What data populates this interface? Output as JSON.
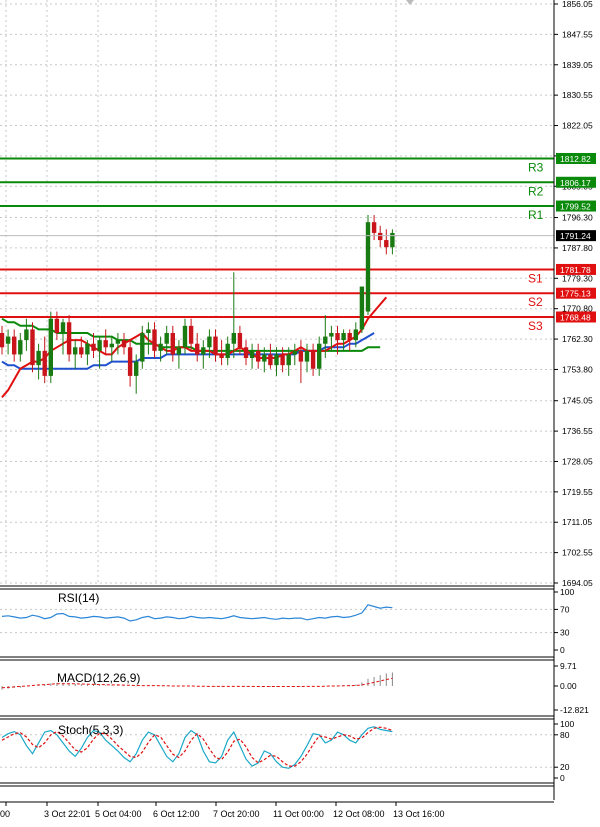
{
  "colors": {
    "up": "#1a7a12",
    "down": "#c8141a",
    "resistance": "#0a8a0a",
    "support": "#e01010",
    "ma_red": "#e01010",
    "ma_blue": "#2050d0",
    "ma_green": "#0a8a0a",
    "rsi_line": "#2a86d8",
    "stoch_main": "#1aa8c8",
    "stoch_signal": "#e01010",
    "grid": "#c8c8c8"
  },
  "chart_data": {
    "type": "candlestick",
    "price_axis": {
      "ticks": [
        "1856.05",
        "1847.55",
        "1839.05",
        "1830.55",
        "1822.05",
        "1813.55",
        "1805.05",
        "1796.30",
        "1787.80",
        "1779.30",
        "1770.80",
        "1762.30",
        "1753.80",
        "1745.05",
        "1736.55",
        "1728.05",
        "1719.55",
        "1711.05",
        "1702.55",
        "1694.05"
      ],
      "ylim": [
        1694.05,
        1856.05
      ],
      "current_price": "1791.24"
    },
    "x_labels": [
      "00",
      "3 Oct 22:01",
      "5 Oct 04:00",
      "6 Oct 12:00",
      "7 Oct 20:00",
      "11 Oct 00:00",
      "12 Oct 08:00",
      "13 Oct 16:00"
    ],
    "resistance": [
      {
        "label": "R3",
        "value": "1812.82"
      },
      {
        "label": "R2",
        "value": "1806.17"
      },
      {
        "label": "R1",
        "value": "1799.52"
      }
    ],
    "support": [
      {
        "label": "S1",
        "value": "1781.78"
      },
      {
        "label": "S2",
        "value": "1775.13"
      },
      {
        "label": "S3",
        "value": "1768.48"
      }
    ],
    "candles": [
      [
        1764,
        1766,
        1758,
        1760
      ],
      [
        1761,
        1765,
        1758,
        1763
      ],
      [
        1763,
        1765,
        1756,
        1758
      ],
      [
        1758,
        1764,
        1756,
        1762
      ],
      [
        1762,
        1768,
        1759,
        1765
      ],
      [
        1765,
        1767,
        1753,
        1755
      ],
      [
        1755,
        1761,
        1751,
        1759
      ],
      [
        1759,
        1763,
        1750,
        1752
      ],
      [
        1752,
        1770,
        1750,
        1768
      ],
      [
        1768,
        1770,
        1762,
        1764
      ],
      [
        1764,
        1768,
        1758,
        1767
      ],
      [
        1767,
        1769,
        1756,
        1758
      ],
      [
        1758,
        1762,
        1754,
        1760
      ],
      [
        1760,
        1763,
        1757,
        1758
      ],
      [
        1758,
        1762,
        1755,
        1761
      ],
      [
        1761,
        1764,
        1757,
        1759
      ],
      [
        1759,
        1763,
        1754,
        1762
      ],
      [
        1762,
        1765,
        1758,
        1760
      ],
      [
        1760,
        1763,
        1756,
        1761
      ],
      [
        1761,
        1764,
        1758,
        1762
      ],
      [
        1762,
        1764,
        1758,
        1760
      ],
      [
        1760,
        1762,
        1749,
        1752
      ],
      [
        1752,
        1758,
        1747,
        1756
      ],
      [
        1756,
        1766,
        1754,
        1764
      ],
      [
        1764,
        1767,
        1758,
        1765
      ],
      [
        1765,
        1767,
        1757,
        1759
      ],
      [
        1759,
        1763,
        1756,
        1761
      ],
      [
        1761,
        1766,
        1758,
        1764
      ],
      [
        1764,
        1766,
        1756,
        1758
      ],
      [
        1758,
        1762,
        1754,
        1760
      ],
      [
        1760,
        1768,
        1758,
        1766
      ],
      [
        1766,
        1768,
        1759,
        1761
      ],
      [
        1761,
        1764,
        1756,
        1758
      ],
      [
        1758,
        1762,
        1754,
        1760
      ],
      [
        1760,
        1765,
        1757,
        1763
      ],
      [
        1763,
        1765,
        1756,
        1758
      ],
      [
        1758,
        1762,
        1755,
        1757
      ],
      [
        1757,
        1763,
        1755,
        1761
      ],
      [
        1761,
        1781,
        1757,
        1764
      ],
      [
        1764,
        1766,
        1758,
        1760
      ],
      [
        1760,
        1762,
        1755,
        1757
      ],
      [
        1757,
        1761,
        1754,
        1759
      ],
      [
        1759,
        1761,
        1754,
        1756
      ],
      [
        1756,
        1760,
        1753,
        1758
      ],
      [
        1758,
        1761,
        1754,
        1755
      ],
      [
        1755,
        1760,
        1752,
        1758
      ],
      [
        1758,
        1760,
        1753,
        1755
      ],
      [
        1755,
        1760,
        1752,
        1758
      ],
      [
        1758,
        1761,
        1755,
        1759
      ],
      [
        1759,
        1762,
        1750,
        1756
      ],
      [
        1756,
        1761,
        1753,
        1759
      ],
      [
        1759,
        1761,
        1752,
        1754
      ],
      [
        1754,
        1763,
        1752,
        1761
      ],
      [
        1761,
        1769,
        1757,
        1763
      ],
      [
        1763,
        1766,
        1759,
        1764
      ],
      [
        1764,
        1766,
        1758,
        1762
      ],
      [
        1762,
        1765,
        1759,
        1764
      ],
      [
        1764,
        1765,
        1759,
        1762
      ],
      [
        1762,
        1767,
        1760,
        1765
      ],
      [
        1765,
        1770,
        1764,
        1777
      ],
      [
        1770,
        1797,
        1769,
        1795
      ],
      [
        1795,
        1797,
        1790,
        1792
      ],
      [
        1792,
        1794,
        1788,
        1790
      ],
      [
        1790,
        1793,
        1786,
        1788
      ],
      [
        1788,
        1793,
        1786,
        1792
      ]
    ],
    "ma_red": [
      1746,
      1748,
      1751,
      1754,
      1755,
      1756,
      1756,
      1757,
      1759,
      1760,
      1761,
      1762,
      1762,
      1762,
      1761,
      1760,
      1759,
      1758,
      1758,
      1760,
      1761,
      1762,
      1763,
      1764,
      1762,
      1761,
      1760,
      1759,
      1759,
      1760,
      1760,
      1759,
      1759,
      1759,
      1759,
      1758,
      1758,
      1758,
      1759,
      1760,
      1759,
      1758,
      1757,
      1757,
      1757,
      1757,
      1758,
      1758,
      1759,
      1760,
      1759,
      1759,
      1759,
      1759,
      1760,
      1761,
      1761,
      1762,
      1763,
      1765,
      1768,
      1770,
      1772,
      1774
    ],
    "ma_blue": [
      1756,
      1755,
      1755,
      1754,
      1754,
      1754,
      1754,
      1754,
      1754,
      1754,
      1754,
      1754,
      1754,
      1754,
      1754,
      1755,
      1755,
      1755,
      1756,
      1756,
      1756,
      1756,
      1756,
      1757,
      1757,
      1757,
      1757,
      1758,
      1758,
      1758,
      1758,
      1758,
      1758,
      1758,
      1758,
      1758,
      1758,
      1758,
      1758,
      1758,
      1758,
      1758,
      1758,
      1758,
      1758,
      1758,
      1758,
      1758,
      1758,
      1759,
      1759,
      1759,
      1759,
      1760,
      1760,
      1760,
      1760,
      1761,
      1761,
      1762,
      1763,
      1764
    ],
    "ma_green": [
      1768,
      1767,
      1767,
      1766,
      1766,
      1766,
      1765,
      1765,
      1765,
      1764,
      1764,
      1764,
      1764,
      1764,
      1764,
      1763,
      1763,
      1763,
      1763,
      1762,
      1762,
      1762,
      1761,
      1761,
      1761,
      1761,
      1760,
      1760,
      1760,
      1760,
      1760,
      1760,
      1759,
      1759,
      1759,
      1759,
      1759,
      1759,
      1759,
      1759,
      1759,
      1759,
      1759,
      1759,
      1759,
      1759,
      1759,
      1759,
      1759,
      1759,
      1759,
      1759,
      1759,
      1759,
      1759,
      1759,
      1759,
      1759,
      1759,
      1759,
      1760,
      1760,
      1760
    ],
    "rsi": {
      "label": "RSI(14)",
      "ticks": [
        "100",
        "70",
        "30",
        "0"
      ],
      "values": [
        58,
        59,
        57,
        55,
        56,
        60,
        58,
        54,
        56,
        62,
        63,
        58,
        57,
        55,
        56,
        58,
        57,
        55,
        56,
        57,
        55,
        50,
        52,
        56,
        58,
        54,
        55,
        57,
        56,
        54,
        55,
        58,
        56,
        55,
        56,
        55,
        54,
        56,
        59,
        56,
        55,
        54,
        55,
        56,
        54,
        53,
        55,
        54,
        55,
        55,
        52,
        54,
        56,
        55,
        57,
        58,
        56,
        57,
        60,
        64,
        78,
        75,
        72,
        74,
        73
      ]
    },
    "macd": {
      "label": "MACD(12,26,9)",
      "ticks": [
        "9.71",
        "0.00",
        "-12.821"
      ],
      "values": [
        -2,
        -1.5,
        -1,
        -1,
        0,
        0.5,
        0.5,
        1,
        1.5,
        1.8,
        1.8,
        1.5,
        1.2,
        1,
        0.8,
        0.6,
        0.5,
        0.4,
        0.3,
        0.5,
        0.3,
        0,
        -0.2,
        0,
        0.2,
        0.2,
        0.1,
        0,
        -0.1,
        0,
        0.1,
        0,
        -0.1,
        -0.2,
        -0.2,
        -0.3,
        -0.3,
        -0.2,
        -0.1,
        -0.1,
        -0.2,
        -0.3,
        -0.3,
        -0.4,
        -0.4,
        -0.4,
        -0.3,
        -0.3,
        -0.3,
        -0.2,
        -0.2,
        -0.2,
        -0.1,
        0,
        0.1,
        0.2,
        0.3,
        0.5,
        0.8,
        2,
        4,
        5,
        6,
        7,
        7.5
      ],
      "signal": [
        -1,
        -0.8,
        -0.5,
        -0.2,
        0,
        0.3,
        0.6,
        0.8,
        1,
        1.2,
        1.3,
        1.3,
        1.2,
        1.1,
        1,
        0.9,
        0.8,
        0.7,
        0.6,
        0.6,
        0.5,
        0.4,
        0.3,
        0.2,
        0.2,
        0.2,
        0.1,
        0.1,
        0,
        0,
        0,
        0,
        -0.1,
        -0.1,
        -0.2,
        -0.2,
        -0.2,
        -0.2,
        -0.2,
        -0.2,
        -0.2,
        -0.2,
        -0.3,
        -0.3,
        -0.3,
        -0.3,
        -0.3,
        -0.3,
        -0.3,
        -0.3,
        -0.2,
        -0.2,
        -0.2,
        -0.1,
        0,
        0,
        0.1,
        0.2,
        0.3,
        0.6,
        1.2,
        2,
        2.8,
        3.6,
        4.3
      ]
    },
    "stoch": {
      "label": "Stoch(5,3,3)",
      "ticks": [
        "100",
        "80",
        "20",
        "0"
      ],
      "main": [
        75,
        82,
        86,
        80,
        60,
        45,
        65,
        85,
        88,
        80,
        65,
        50,
        40,
        55,
        75,
        88,
        85,
        70,
        60,
        50,
        38,
        30,
        45,
        70,
        85,
        80,
        60,
        40,
        30,
        45,
        75,
        88,
        80,
        50,
        30,
        28,
        40,
        70,
        85,
        60,
        35,
        22,
        28,
        50,
        45,
        30,
        20,
        18,
        25,
        40,
        60,
        82,
        80,
        65,
        70,
        85,
        80,
        70,
        65,
        80,
        92,
        95,
        90,
        88,
        86
      ],
      "signal": [
        70,
        76,
        82,
        84,
        76,
        62,
        56,
        65,
        80,
        86,
        78,
        65,
        52,
        48,
        56,
        72,
        83,
        82,
        72,
        60,
        50,
        40,
        38,
        48,
        66,
        80,
        76,
        60,
        44,
        38,
        50,
        70,
        82,
        72,
        54,
        38,
        34,
        48,
        68,
        72,
        58,
        38,
        28,
        34,
        42,
        40,
        30,
        22,
        22,
        30,
        44,
        62,
        78,
        76,
        72,
        76,
        80,
        78,
        72,
        74,
        84,
        92,
        94,
        92,
        88
      ]
    }
  }
}
